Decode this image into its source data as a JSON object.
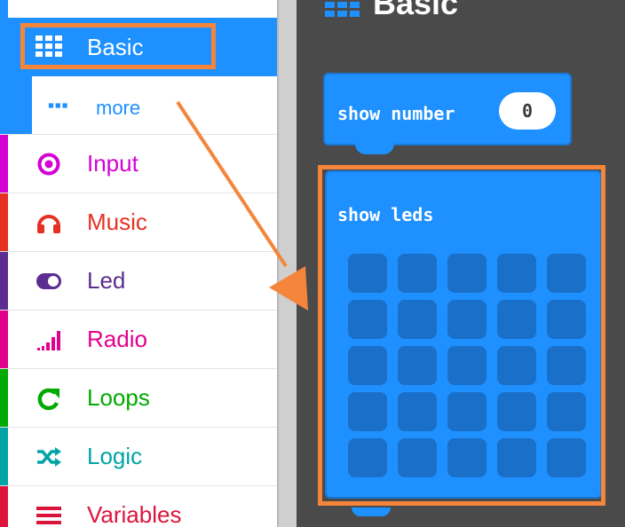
{
  "toolbox": {
    "categories": [
      {
        "id": "basic",
        "label": "Basic",
        "icon": "grid-icon",
        "color": "#1e90ff"
      },
      {
        "id": "more",
        "label": "more",
        "icon": "ellipsis-icon",
        "color": "#1e90ff"
      },
      {
        "id": "input",
        "label": "Input",
        "icon": "target-icon",
        "color": "#d400d4"
      },
      {
        "id": "music",
        "label": "Music",
        "icon": "headphones-icon",
        "color": "#e63022"
      },
      {
        "id": "led",
        "label": "Led",
        "icon": "toggle-icon",
        "color": "#5c2d91"
      },
      {
        "id": "radio",
        "label": "Radio",
        "icon": "signal-bars-icon",
        "color": "#e3008c"
      },
      {
        "id": "loops",
        "label": "Loops",
        "icon": "loop-arrow-icon",
        "color": "#00aa00"
      },
      {
        "id": "logic",
        "label": "Logic",
        "icon": "shuffle-icon",
        "color": "#00a4a6"
      },
      {
        "id": "variables",
        "label": "Variables",
        "icon": "hamburger-icon",
        "color": "#dc143c"
      }
    ]
  },
  "workspace": {
    "flyout_title": "Basic",
    "blocks": {
      "show_number": {
        "label": "show number",
        "value": "0"
      },
      "show_leds": {
        "label": "show leds",
        "grid_rows": 5,
        "grid_cols": 5
      }
    }
  },
  "annotation": {
    "highlight_color": "#f5853a"
  }
}
